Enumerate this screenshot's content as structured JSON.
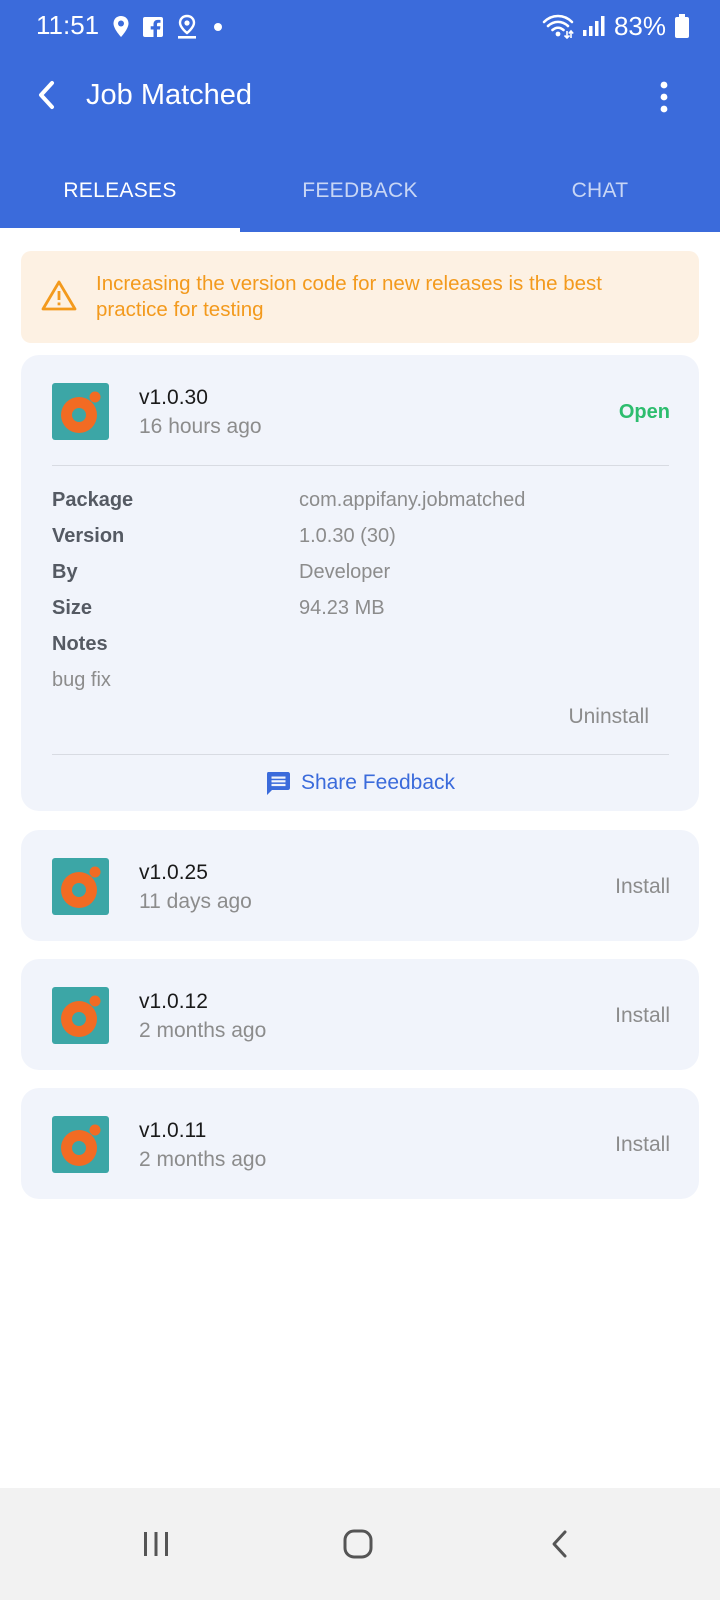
{
  "status_bar": {
    "time": "11:51",
    "battery": "83%",
    "left_icons": [
      "location-icon",
      "facebook-icon",
      "maps-pin-icon",
      "dot-icon"
    ],
    "right_icons": [
      "wifi-icon",
      "signal-icon",
      "battery-icon"
    ]
  },
  "app_bar": {
    "title": "Job Matched",
    "back_icon": "arrow-back-icon",
    "menu_icon": "more-vert-icon",
    "color": "#3b6bdb"
  },
  "tabs": [
    {
      "label": "RELEASES",
      "active": true
    },
    {
      "label": "FEEDBACK",
      "active": false
    },
    {
      "label": "CHAT",
      "active": false
    }
  ],
  "warning": {
    "text": "Increasing the version code for new releases is the best practice for testing",
    "icon": "warning-icon",
    "color": "#f39a1d"
  },
  "releases": [
    {
      "version": "v1.0.30",
      "ago": "16 hours ago",
      "action": "Open",
      "expanded": true,
      "details": {
        "package_label": "Package",
        "package": "com.appifany.jobmatched",
        "version_label": "Version",
        "version": "1.0.30 (30)",
        "by_label": "By",
        "by": "Developer",
        "size_label": "Size",
        "size": "94.23 MB",
        "notes_label": "Notes",
        "notes": "bug fix"
      },
      "secondary_action": "Uninstall",
      "share_label": "Share Feedback"
    },
    {
      "version": "v1.0.25",
      "ago": "11 days ago",
      "action": "Install"
    },
    {
      "version": "v1.0.12",
      "ago": "2 months ago",
      "action": "Install"
    },
    {
      "version": "v1.0.11",
      "ago": "2 months ago",
      "action": "Install"
    }
  ],
  "nav_bar": {
    "icons": [
      "recents-icon",
      "home-icon",
      "back-icon"
    ]
  },
  "colors": {
    "accent": "#3b6bdb",
    "open_green": "#2dbd6e",
    "card_bg": "#f1f4fb",
    "icon_teal": "#3ca6a6",
    "icon_orange": "#f26b23"
  }
}
